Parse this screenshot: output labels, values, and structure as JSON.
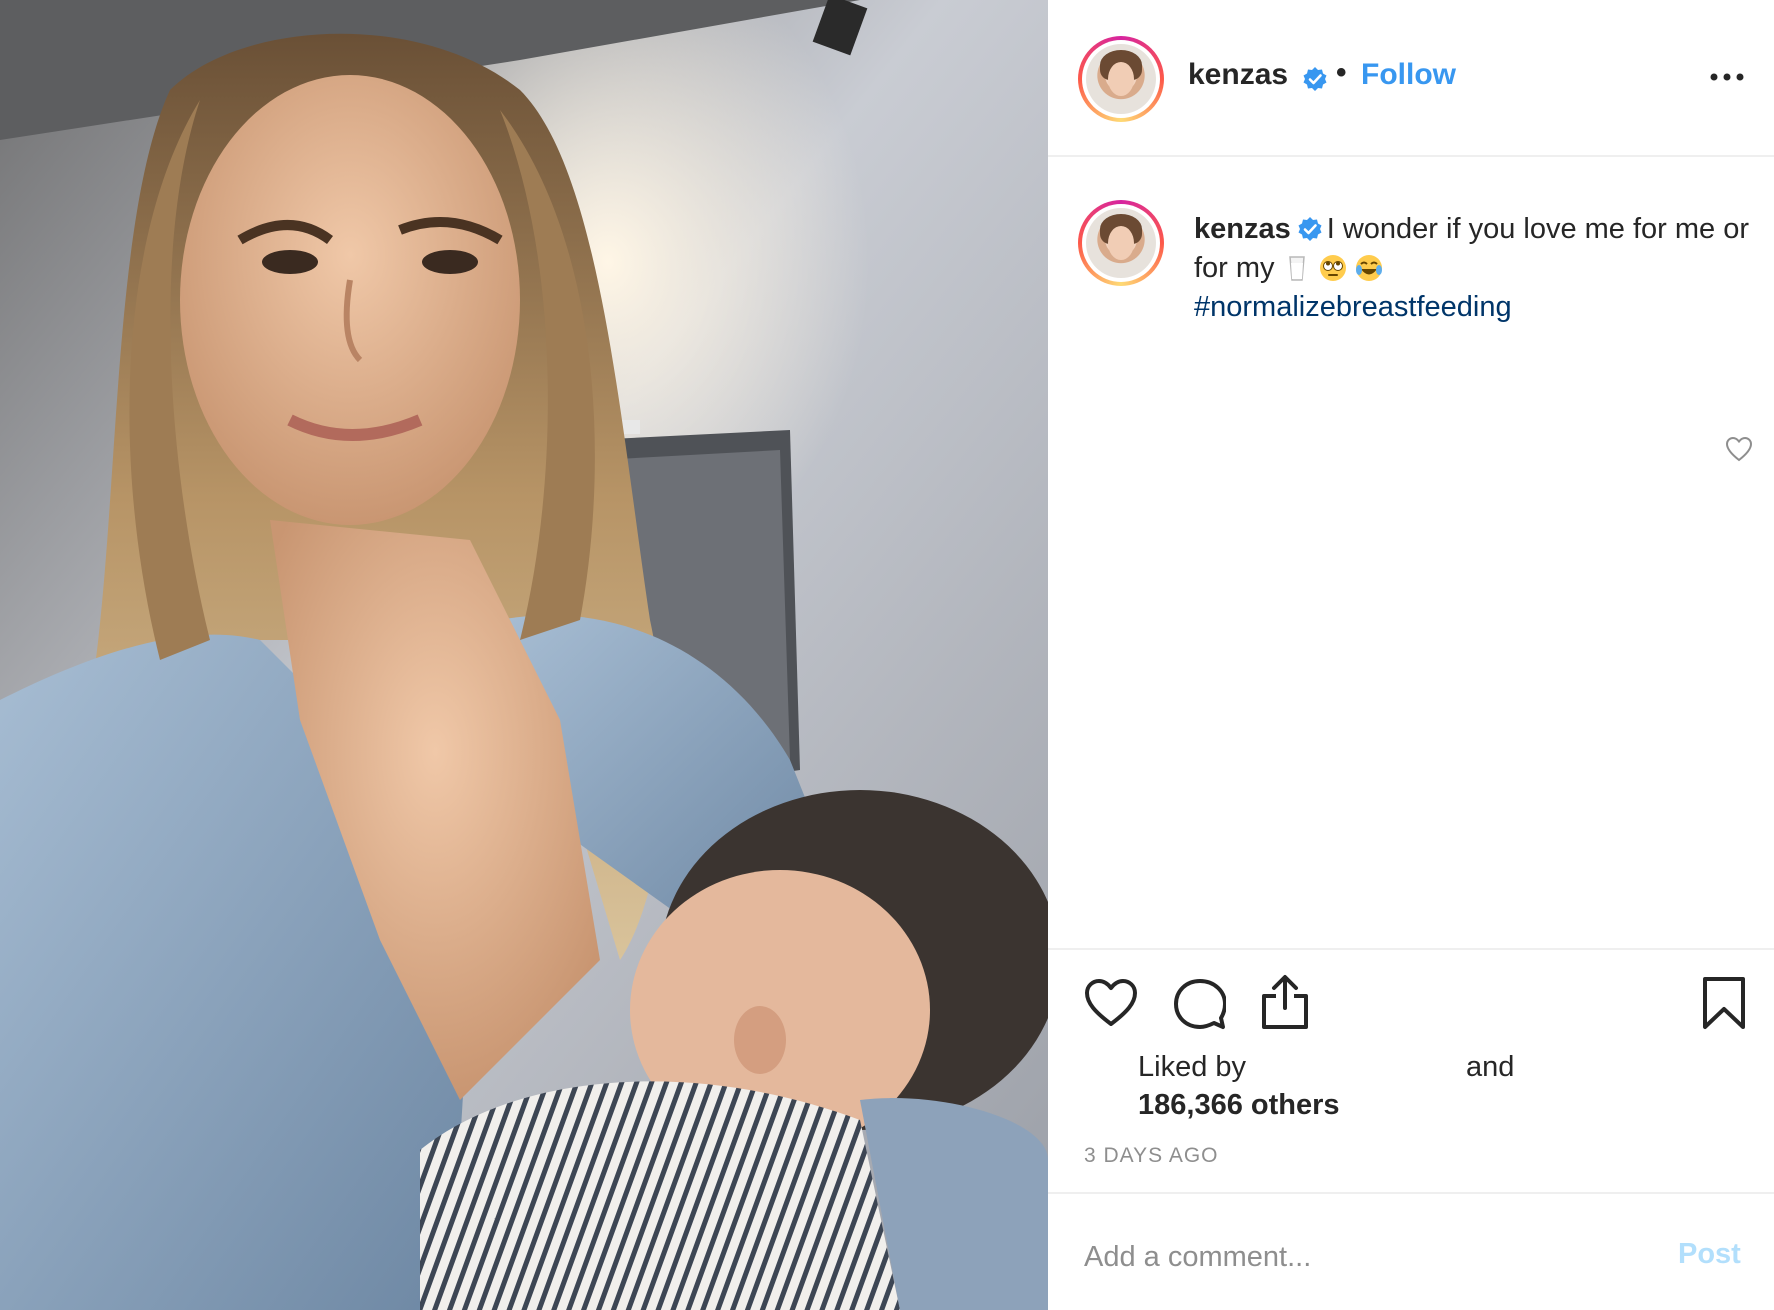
{
  "post": {
    "username": "kenzas",
    "verified": true,
    "follow_label": "Follow",
    "separator": "•"
  },
  "caption": {
    "username": "kenzas",
    "text": "I wonder if you love me for me or for my",
    "emojis": [
      "milk-glass-emoji",
      "rolling-eyes-emoji",
      "tears-of-joy-emoji"
    ],
    "hashtag": "#normalizebreastfeeding"
  },
  "likes": {
    "prefix": "Liked by",
    "and_label": "and",
    "count_text": "186,366 others"
  },
  "timestamp": "3 DAYS AGO",
  "comment": {
    "placeholder": "Add a comment...",
    "post_label": "Post"
  },
  "colors": {
    "link": "#3897f0",
    "hashtag": "#003569",
    "muted": "#8e8e8e",
    "post_disabled": "#b2dffc",
    "border": "#efefef",
    "text": "#262626"
  }
}
